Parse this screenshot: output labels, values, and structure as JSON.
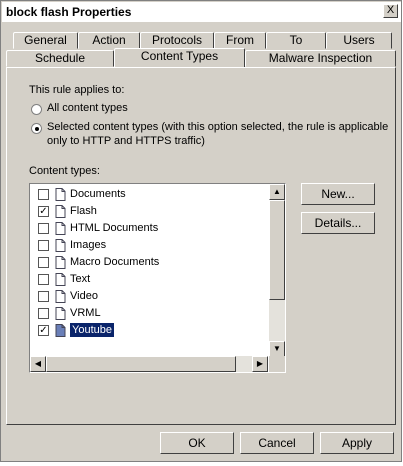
{
  "window": {
    "title": "block flash Properties",
    "close_glyph": "X"
  },
  "tabs_row1": [
    "General",
    "Action",
    "Protocols",
    "From",
    "To",
    "Users"
  ],
  "tabs_row2": [
    "Schedule",
    "Content Types",
    "Malware Inspection"
  ],
  "active_tab": "Content Types",
  "applies_label": "This rule applies to:",
  "radio_all": "All content types",
  "radio_selected_line1": "Selected content types (with this option selected, the rule is applicable",
  "radio_selected_line2": "only to HTTP and HTTPS traffic)",
  "content_types_label": "Content types:",
  "content_types": [
    {
      "label": "Documents",
      "checked": false
    },
    {
      "label": "Flash",
      "checked": true
    },
    {
      "label": "HTML Documents",
      "checked": false
    },
    {
      "label": "Images",
      "checked": false
    },
    {
      "label": "Macro Documents",
      "checked": false
    },
    {
      "label": "Text",
      "checked": false
    },
    {
      "label": "Video",
      "checked": false
    },
    {
      "label": "VRML",
      "checked": false
    },
    {
      "label": "Youtube",
      "checked": true,
      "selected": true
    }
  ],
  "buttons": {
    "new": "New...",
    "details": "Details...",
    "ok": "OK",
    "cancel": "Cancel",
    "apply": "Apply"
  },
  "colors": {
    "selection": "#0a246a",
    "face": "#d4d0c8"
  }
}
